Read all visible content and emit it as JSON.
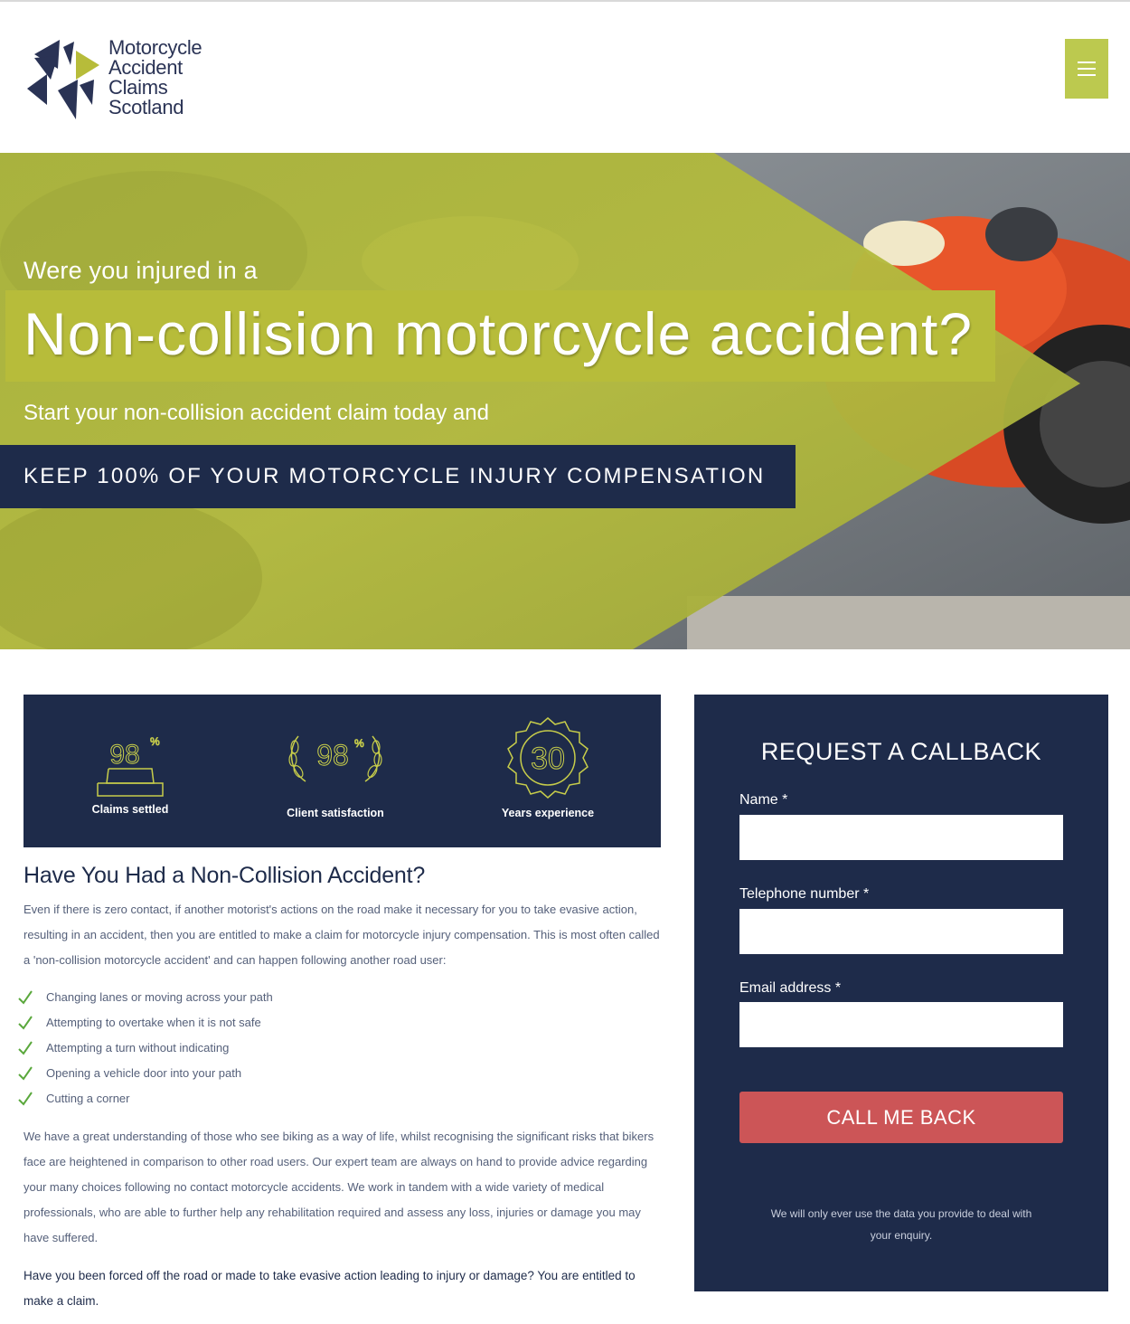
{
  "logo": {
    "lines": [
      "Motorcycle",
      "Accident",
      "Claims",
      "Scotland"
    ]
  },
  "hero": {
    "intro": "Were you injured in a",
    "title": "Non-collision motorcycle accident?",
    "sub": "Start your non-collision accident claim today and",
    "band": "KEEP 100% OF YOUR MOTORCYCLE INJURY COMPENSATION"
  },
  "stats": [
    {
      "value": "98",
      "suffix": "%",
      "label": "Claims settled",
      "icon": "podium-icon"
    },
    {
      "value": "98",
      "suffix": "%",
      "label": "Client satisfaction",
      "icon": "laurel-icon"
    },
    {
      "value": "30",
      "suffix": "",
      "label": "Years experience",
      "icon": "badge-icon"
    }
  ],
  "content": {
    "heading": "Have You Had a Non-Collision Accident?",
    "intro": "Even if there is zero contact, if another motorist's actions on the road make it necessary for you to take evasive action, resulting in an accident, then you are entitled to make a claim for motorcycle injury compensation. This is most often called a 'non-collision motorcycle accident' and can happen following another road user:",
    "checklist": [
      "Changing lanes or moving across your path",
      "Attempting to overtake when it is not safe",
      "Attempting a turn without indicating",
      "Opening a vehicle door into your path",
      "Cutting a corner"
    ],
    "body": "We have a great understanding of those who see biking as a way of life, whilst recognising the significant risks that bikers face are heightened in comparison to other road users. Our expert team are always on hand to provide advice regarding your many choices following no contact motorcycle accidents. We work in tandem with a wide variety of medical professionals, who are able to further help any rehabilitation required and assess any loss, injuries or damage you may have suffered.",
    "closing": "Have you been forced off the road or made to take evasive action leading to injury or damage? You are entitled to make a claim."
  },
  "form": {
    "title": "REQUEST A CALLBACK",
    "name_label": "Name *",
    "phone_label": "Telephone number *",
    "email_label": "Email address *",
    "name_value": "",
    "phone_value": "",
    "email_value": "",
    "button": "CALL ME BACK",
    "note": "We will only ever use the data you provide to deal with your enquiry."
  },
  "colors": {
    "navy": "#1e2b4a",
    "lime": "#b7bc3a",
    "menu": "#bcc94f",
    "button": "#cc5557",
    "check": "#5aa83c"
  }
}
